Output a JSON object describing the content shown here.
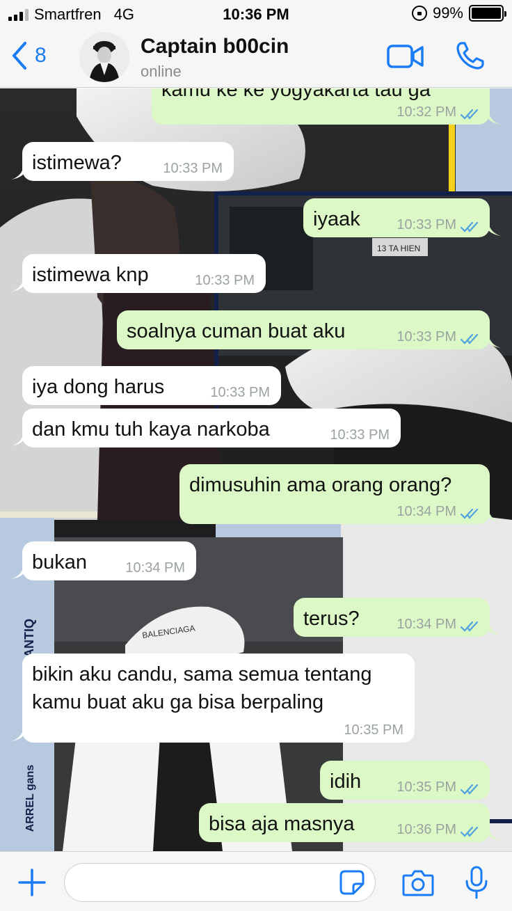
{
  "status_bar": {
    "carrier": "Smartfren",
    "network": "4G",
    "time": "10:36 PM",
    "battery": "99%",
    "battery_level": 0.99,
    "signal_bars": 3
  },
  "header": {
    "back_count": "8",
    "contact_name": "Captain b00cin",
    "contact_status": "online"
  },
  "messages": [
    {
      "dir": "out",
      "text": "kamu ke ke yogyakarta tau ga",
      "time": "10:32 PM",
      "read": true
    },
    {
      "dir": "in",
      "text": "istimewa?",
      "time": "10:33 PM"
    },
    {
      "dir": "out",
      "text": "iyaak",
      "time": "10:33 PM",
      "read": true
    },
    {
      "dir": "in",
      "text": "istimewa knp",
      "time": "10:33 PM"
    },
    {
      "dir": "out",
      "text": "soalnya cuman buat aku",
      "time": "10:33 PM",
      "read": true
    },
    {
      "dir": "in",
      "text": "iya dong harus",
      "time": "10:33 PM"
    },
    {
      "dir": "in",
      "text": "dan kmu tuh kaya narkoba",
      "time": "10:33 PM"
    },
    {
      "dir": "out",
      "text": "dimusuhin ama orang orang?",
      "time": "10:34 PM",
      "read": true
    },
    {
      "dir": "in",
      "text": "bukan",
      "time": "10:34 PM"
    },
    {
      "dir": "out",
      "text": "terus?",
      "time": "10:34 PM",
      "read": true
    },
    {
      "dir": "in",
      "text": "bikin aku candu, sama semua tentang kamu buat aku ga bisa berpaling",
      "time": "10:35 PM"
    },
    {
      "dir": "out",
      "text": "idih",
      "time": "10:35 PM",
      "read": true
    },
    {
      "dir": "out",
      "text": "bisa aja masnya",
      "time": "10:36 PM",
      "read": true
    }
  ],
  "wallpaper_text": {
    "side_brand": "ANTIQ",
    "side_caption": "ARREL gans",
    "cap_text_1": "BALENCIAGA",
    "sign_text": "13 TA HIEN"
  },
  "composer": {
    "placeholder": ""
  },
  "icons": {
    "back": "chevron-left-icon",
    "video": "video-camera-icon",
    "call": "phone-icon",
    "add": "plus-icon",
    "sticker": "sticker-icon",
    "camera": "camera-icon",
    "mic": "microphone-icon"
  },
  "colors": {
    "accent": "#1a7cf5",
    "bubble_out": "#dcf8c6",
    "bubble_in": "#ffffff",
    "read_ticks": "#4fa3e0",
    "wallpaper_yellow": "#f4d21c",
    "wallpaper_navy": "#12204a",
    "wallpaper_blue": "#b7c9de"
  }
}
